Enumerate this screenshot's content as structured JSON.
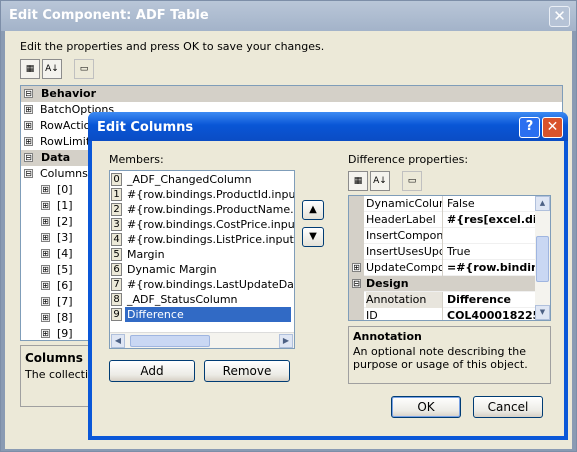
{
  "outer": {
    "title": "Edit Component: ADF Table",
    "close": "✕",
    "instructions": "Edit the properties and press OK to save your changes.",
    "toolbar": {
      "categorized": "▦",
      "alphabetical": "A↓",
      "pages": "▭"
    },
    "rows": [
      {
        "kind": "cat",
        "pm": "⊟",
        "label": "Behavior"
      },
      {
        "kind": "prop",
        "pm": "⊞",
        "label": "BatchOptions"
      },
      {
        "kind": "prop",
        "pm": "⊞",
        "label": "RowActions"
      },
      {
        "kind": "prop",
        "pm": "⊞",
        "label": "RowLimit"
      },
      {
        "kind": "cat",
        "pm": "⊟",
        "label": "Data"
      },
      {
        "kind": "prop",
        "pm": "⊟",
        "label": "Columns"
      },
      {
        "kind": "sub",
        "pm": "⊞",
        "label": "[0]"
      },
      {
        "kind": "sub",
        "pm": "⊞",
        "label": "[1]"
      },
      {
        "kind": "sub",
        "pm": "⊞",
        "label": "[2]"
      },
      {
        "kind": "sub",
        "pm": "⊞",
        "label": "[3]"
      },
      {
        "kind": "sub",
        "pm": "⊞",
        "label": "[4]"
      },
      {
        "kind": "sub",
        "pm": "⊞",
        "label": "[5]"
      },
      {
        "kind": "sub",
        "pm": "⊞",
        "label": "[6]"
      },
      {
        "kind": "sub",
        "pm": "⊞",
        "label": "[7]"
      },
      {
        "kind": "sub",
        "pm": "⊞",
        "label": "[8]"
      },
      {
        "kind": "sub",
        "pm": "⊞",
        "label": "[9]"
      }
    ],
    "desc_title": "Columns",
    "desc_text": "The collection"
  },
  "dialog": {
    "title": "Edit Columns",
    "help": "?",
    "close": "✕",
    "members_label": "Members:",
    "props_label": "Difference properties:",
    "members": [
      {
        "idx": "0",
        "text": "_ADF_ChangedColumn"
      },
      {
        "idx": "1",
        "text": "#{row.bindings.ProductId.inputValue}"
      },
      {
        "idx": "2",
        "text": "#{row.bindings.ProductName.inputValue}"
      },
      {
        "idx": "3",
        "text": "#{row.bindings.CostPrice.inputValue}"
      },
      {
        "idx": "4",
        "text": "#{row.bindings.ListPrice.inputValue}"
      },
      {
        "idx": "5",
        "text": "Margin"
      },
      {
        "idx": "6",
        "text": "Dynamic Margin"
      },
      {
        "idx": "7",
        "text": "#{row.bindings.LastUpdateDate.inputValue}"
      },
      {
        "idx": "8",
        "text": "_ADF_StatusColumn"
      },
      {
        "idx": "9",
        "text": "Difference"
      }
    ],
    "selected_member": 9,
    "move_up": "▲",
    "move_down": "▼",
    "add_label": "Add",
    "remove_label": "Remove",
    "props_toolbar": {
      "categorized": "▦",
      "alphabetical": "A↓",
      "pages": "▭"
    },
    "props": [
      {
        "kind": "prop",
        "pm": "",
        "name": "DynamicColumn",
        "value": "False",
        "bold": false
      },
      {
        "kind": "prop",
        "pm": "",
        "name": "HeaderLabel",
        "value": "#{res[excel.diff",
        "bold": true
      },
      {
        "kind": "prop",
        "pm": "",
        "name": "InsertComponent",
        "value": "",
        "bold": false
      },
      {
        "kind": "prop",
        "pm": "",
        "name": "InsertUsesUpdate",
        "value": "True",
        "bold": false
      },
      {
        "kind": "prop",
        "pm": "⊞",
        "name": "UpdateComponent",
        "value": "=#{row.binding:",
        "bold": true
      },
      {
        "kind": "cat",
        "pm": "⊟",
        "name": "Design",
        "value": "",
        "bold": true
      },
      {
        "kind": "prop",
        "pm": "",
        "name": "Annotation",
        "value": "Difference",
        "bold": true,
        "selected": true
      },
      {
        "kind": "prop",
        "pm": "",
        "name": "ID",
        "value": "COL400018225",
        "bold": true
      }
    ],
    "desc_title": "Annotation",
    "desc_text": "An optional note describing the purpose or usage of this object.",
    "ok_label": "OK",
    "cancel_label": "Cancel"
  }
}
